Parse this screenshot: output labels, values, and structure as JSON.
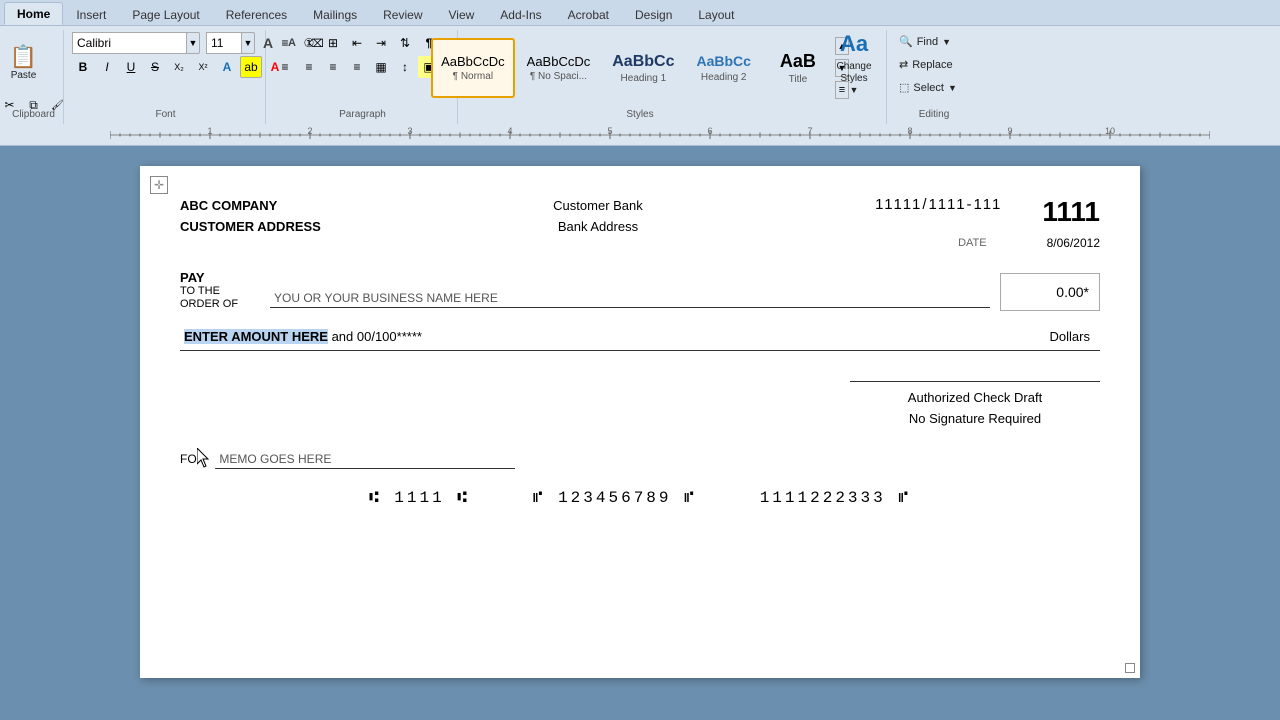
{
  "ribbon": {
    "tabs": [
      "Home",
      "Insert",
      "Page Layout",
      "References",
      "Mailings",
      "Review",
      "View",
      "Add-Ins",
      "Acrobat",
      "Design",
      "Layout"
    ],
    "active_tab": "Home",
    "groups": {
      "clipboard": {
        "label": "Clipboard"
      },
      "font": {
        "label": "Font",
        "name": "Calibri",
        "size": "11",
        "expand_label": "Font"
      },
      "paragraph": {
        "label": "Paragraph",
        "expand_label": "Paragraph"
      },
      "styles": {
        "label": "Styles",
        "items": [
          {
            "id": "normal",
            "preview": "AaBbCcDc",
            "label": "¶ Normal",
            "active": true
          },
          {
            "id": "no-spacing",
            "preview": "AaBbCcDc",
            "label": "¶ No Spaci...",
            "active": false
          },
          {
            "id": "heading1",
            "preview": "AaBbCc",
            "label": "Heading 1",
            "active": false
          },
          {
            "id": "heading2",
            "preview": "AaBbCc",
            "label": "Heading 2",
            "active": false
          },
          {
            "id": "title",
            "preview": "AaB",
            "label": "Title",
            "active": false
          }
        ],
        "expand_label": "Styles"
      },
      "change_styles": {
        "label": "Change\nStyles",
        "icon": "Aa"
      },
      "editing": {
        "label": "Editing",
        "find_label": "Find",
        "replace_label": "Replace",
        "select_label": "Select"
      }
    }
  },
  "check": {
    "company_name": "ABC COMPANY",
    "company_address": "CUSTOMER ADDRESS",
    "bank_name": "Customer Bank",
    "bank_address": "Bank Address",
    "routing_number": "11111/1111-111",
    "check_number": "1111",
    "date_label": "DATE",
    "date_value": "8/06/2012",
    "pay_label": "PAY",
    "pay_to_label": "TO THE\nORDER OF",
    "pay_to_value": "YOU OR YOUR BUSINESS NAME HERE",
    "amount_value": "0.00*",
    "written_amount_highlighted": "ENTER AMOUNT HERE",
    "written_amount_rest": " and 00/100*****",
    "dollars_label": "Dollars",
    "authorized_line1": "Authorized Check Draft",
    "authorized_line2": "No Signature Required",
    "for_label": "FOR",
    "memo_value": "MEMO GOES HERE",
    "micr_line": "⑆ 1111 ⑆     ⑈ 123456789 ⑈     1111222333 ⑈"
  }
}
